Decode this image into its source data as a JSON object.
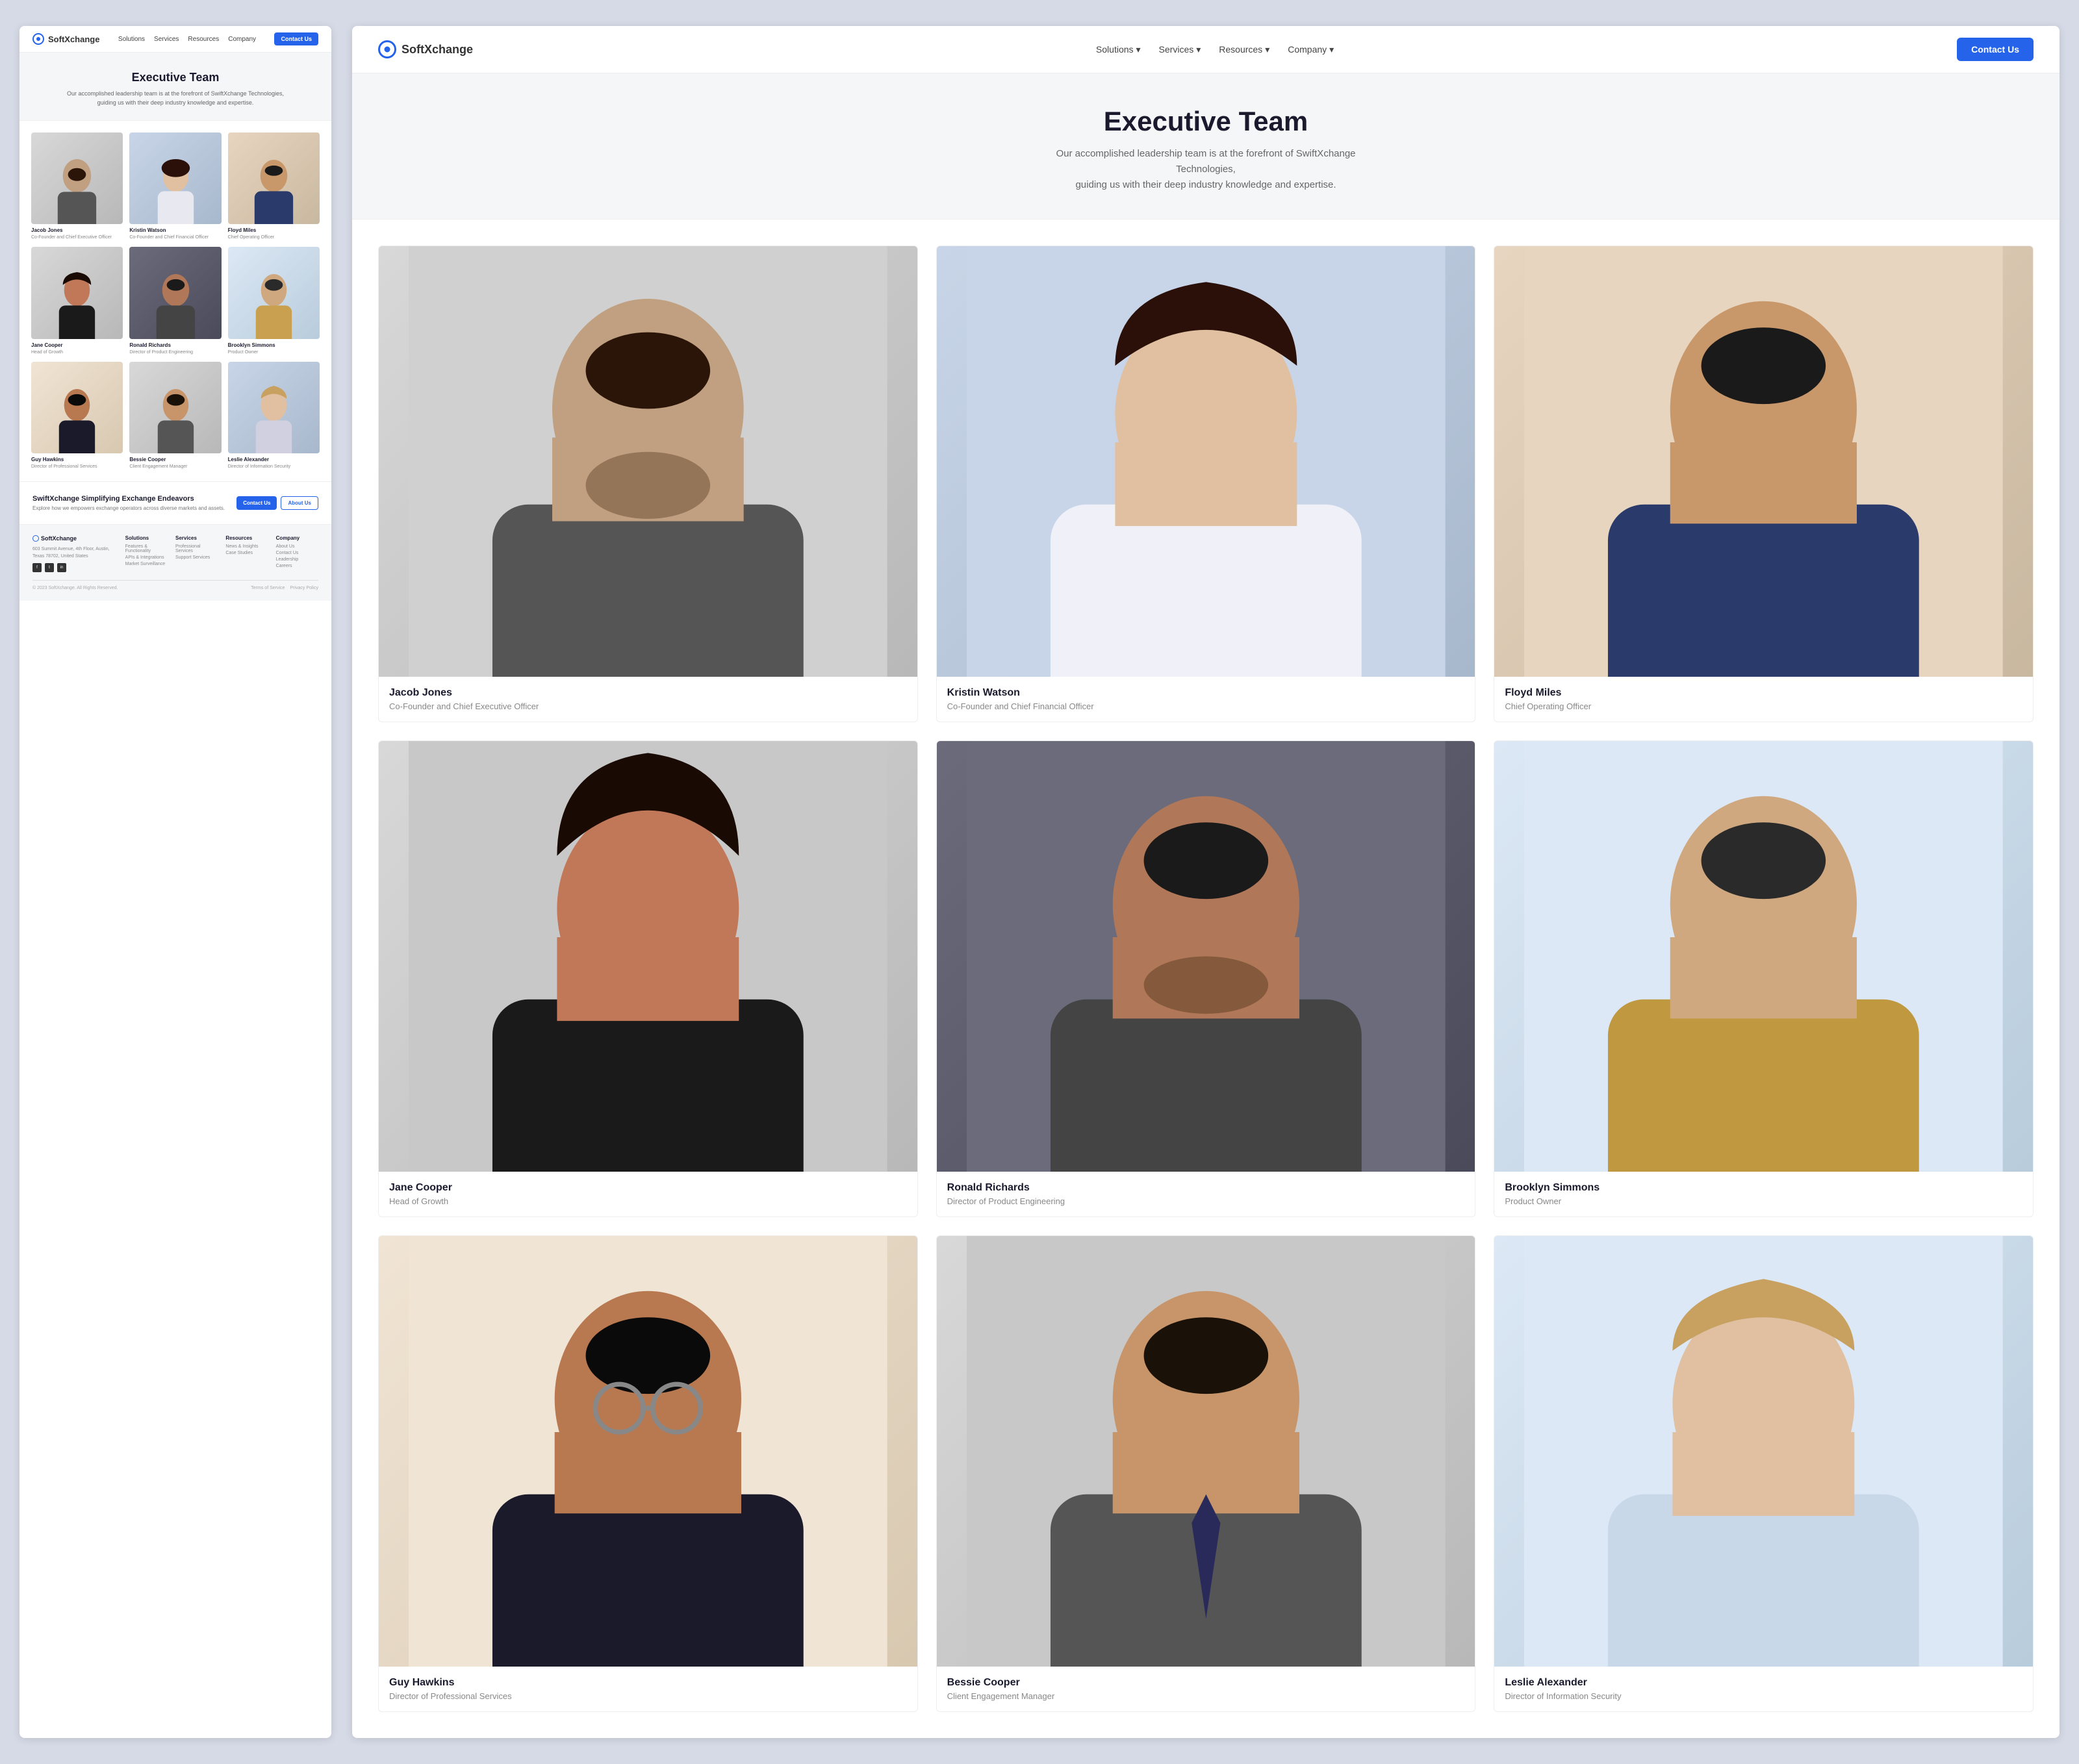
{
  "brand": {
    "name": "SoftXchange",
    "tagline": "SoftXchange"
  },
  "nav": {
    "solutions": "Solutions",
    "services": "Services",
    "resources": "Resources",
    "company": "Company",
    "contact": "Contact Us"
  },
  "hero": {
    "title": "Executive Team",
    "description_line1": "Our accomplished leadership team is at the forefront of SwiftXchange Technologies,",
    "description_line2": "guiding us with their deep industry knowledge and expertise."
  },
  "team": [
    {
      "name": "Jacob Jones",
      "title": "Co-Founder and Chief Executive Officer",
      "bg": "bg-neutral",
      "skin": "#c8a882",
      "hair": "#3a2510"
    },
    {
      "name": "Kristin Watson",
      "title": "Co-Founder and Chief Financial Officer",
      "bg": "bg-cool",
      "skin": "#e8c8a8",
      "hair": "#3a1a08"
    },
    {
      "name": "Floyd Miles",
      "title": "Chief Operating Officer",
      "bg": "bg-warm",
      "skin": "#d4a882",
      "hair": "#1a1a1a"
    },
    {
      "name": "Jane Cooper",
      "title": "Head of Growth",
      "bg": "bg-neutral",
      "skin": "#c8956a",
      "hair": "#1a0a04"
    },
    {
      "name": "Ronald Richards",
      "title": "Director of Product Engineering",
      "bg": "bg-dark",
      "skin": "#b8886a",
      "hair": "#1a1a1a"
    },
    {
      "name": "Brooklyn Simmons",
      "title": "Product Owner",
      "bg": "bg-blue-tint",
      "skin": "#d8b090",
      "hair": "#2a2a2a"
    },
    {
      "name": "Guy Hawkins",
      "title": "Director of Professional Services",
      "bg": "bg-light-warm",
      "skin": "#b87850",
      "hair": "#0a0a0a"
    },
    {
      "name": "Bessie Cooper",
      "title": "Client Engagement Manager",
      "bg": "bg-neutral",
      "skin": "#c8956a",
      "hair": "#1a1208"
    },
    {
      "name": "Leslie Alexander",
      "title": "Director of Information Security",
      "bg": "bg-cool",
      "skin": "#e0c0a0",
      "hair": "#c8a060"
    }
  ],
  "cta": {
    "title": "SwiftXchange Simplifying Exchange Endeavors",
    "description": "Explore how we empowers exchange operators across diverse markets and assets.",
    "btn_contact": "Contact Us",
    "btn_about": "About Us"
  },
  "footer": {
    "brand_address": "603 Summit Avenue, 4th Floor, Austin, Texas 78702, United States",
    "copyright": "© 2023 SoftXchange. All Rights Reserved.",
    "terms": "Terms of Service",
    "privacy": "Privacy Policy",
    "columns": [
      {
        "heading": "Solutions",
        "links": [
          "Features & Functionality",
          "APIs & Integrations",
          "Market Surveillance"
        ]
      },
      {
        "heading": "Services",
        "links": [
          "Professional Services",
          "Support Services"
        ]
      },
      {
        "heading": "Resources",
        "links": [
          "News & Insights",
          "Case Studies"
        ]
      },
      {
        "heading": "Company",
        "links": [
          "About Us",
          "Contact Us",
          "Leadership",
          "Careers"
        ]
      }
    ]
  }
}
